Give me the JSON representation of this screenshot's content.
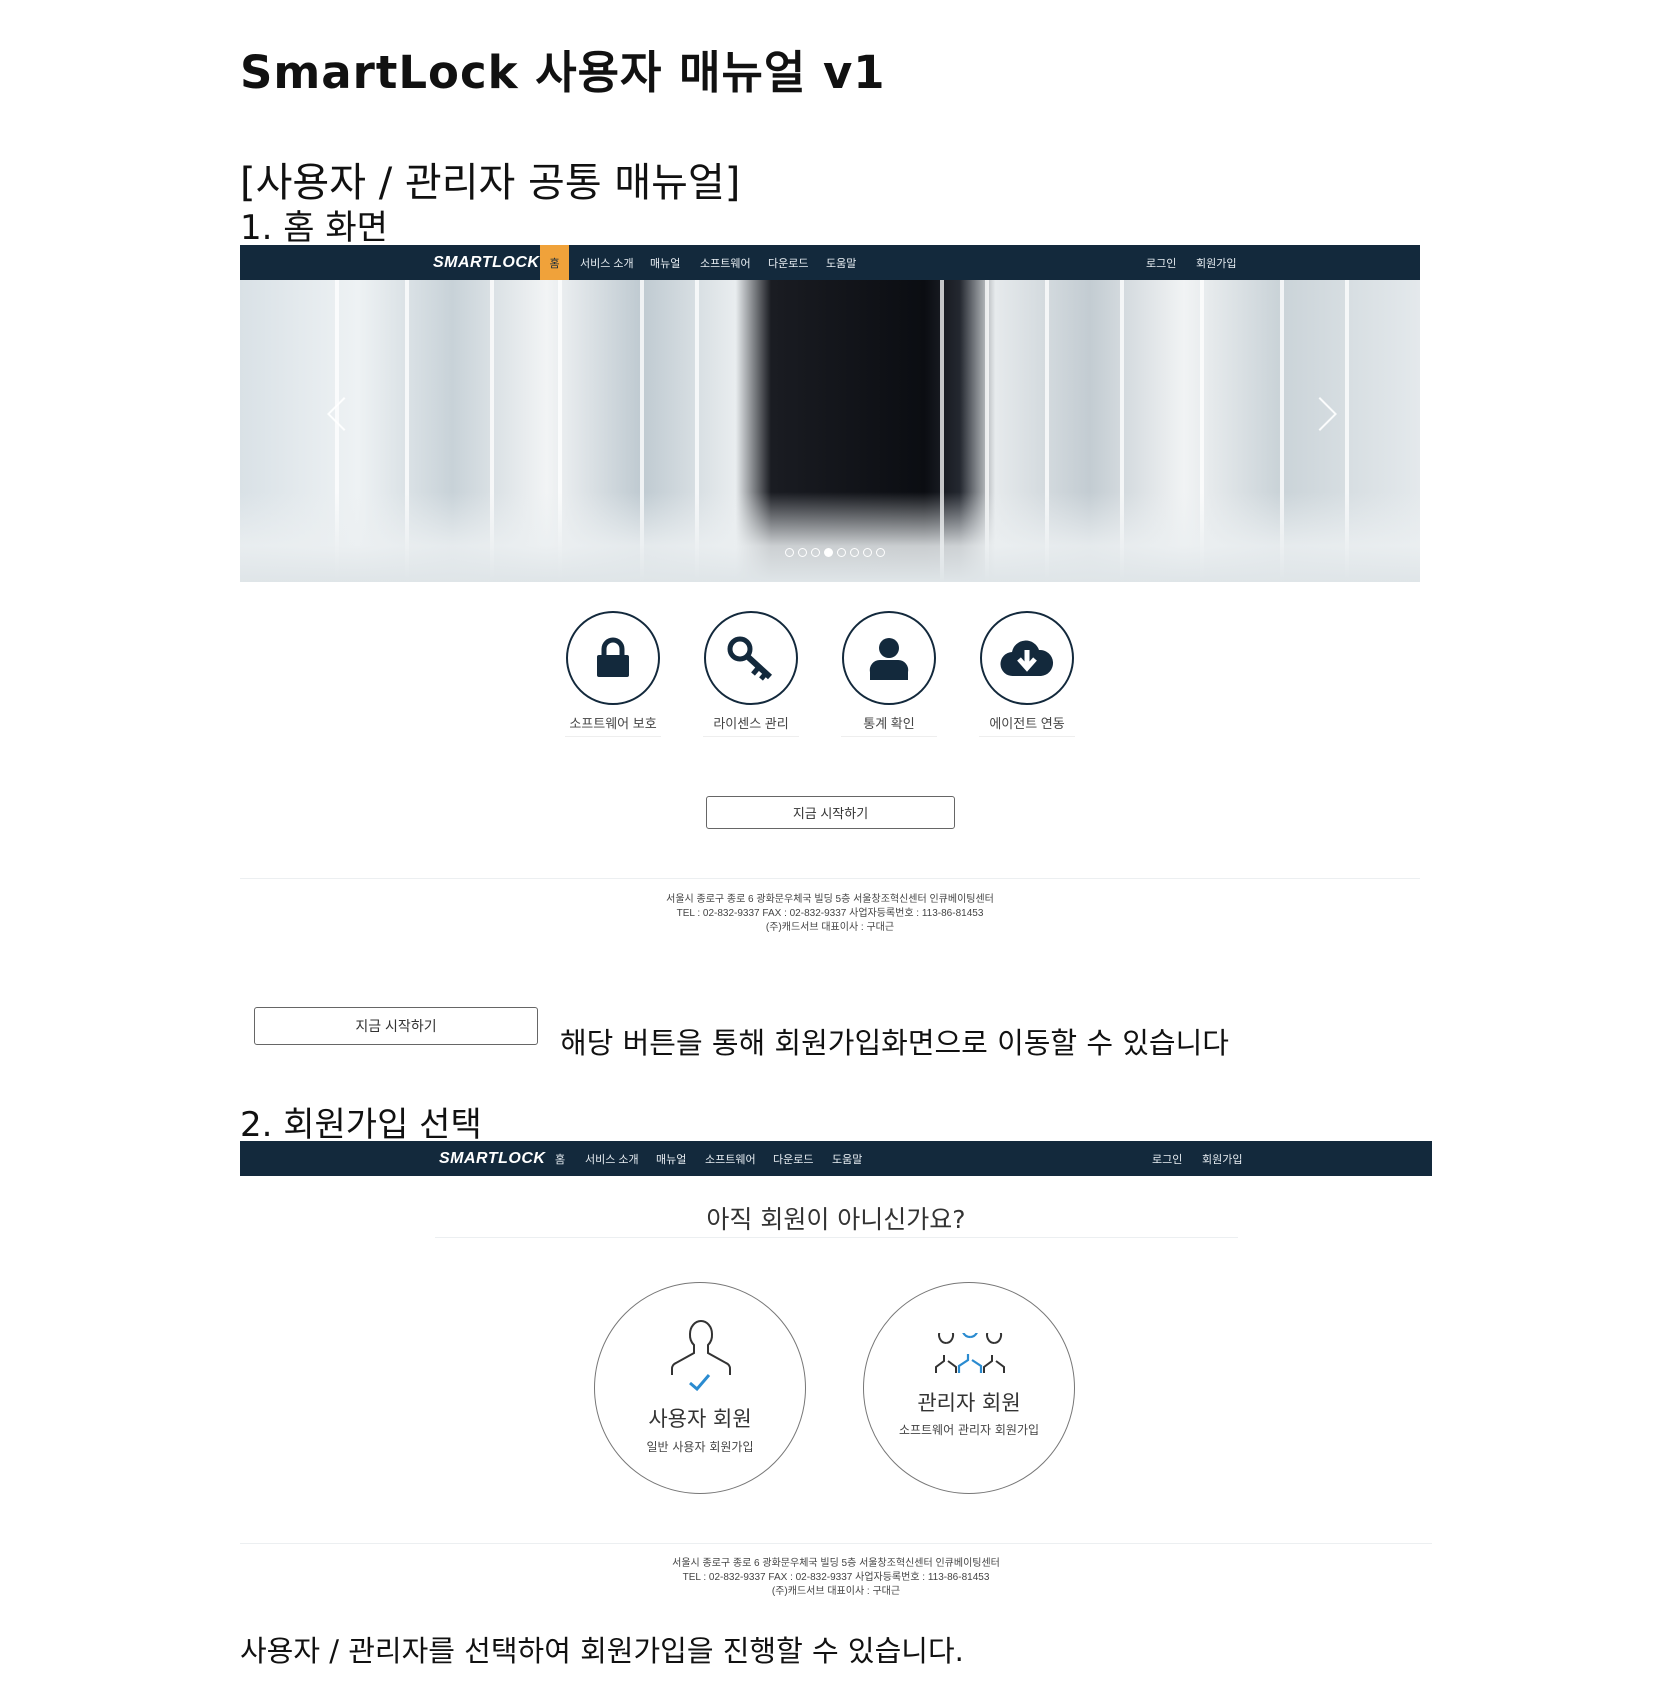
{
  "document": {
    "title": "SmartLock 사용자 매뉴얼 v1",
    "section_heading": "[사용자 / 관리자 공통 매뉴얼]",
    "step1_heading": "1. 홈 화면",
    "step1_description": "해당 버튼을 통해 회원가입화면으로 이동할 수 있습니다",
    "step2_heading": "2. 회원가입 선택",
    "step2_description": "사용자 / 관리자를 선택하여 회원가입을 진행할 수 있습니다."
  },
  "nav": {
    "logo": "SMARTLOCK",
    "items": [
      "홈",
      "서비스 소개",
      "매뉴얼",
      "소프트웨어",
      "다운로드",
      "도움말"
    ],
    "login": "로그인",
    "signup": "회원가입",
    "active_color": "#f0a23a",
    "bar_color": "#13293c"
  },
  "home_screen": {
    "carousel": {
      "slide_count": 8,
      "active_slide": 4
    },
    "features": [
      {
        "icon": "lock-icon",
        "label": "소프트웨어 보호"
      },
      {
        "icon": "key-icon",
        "label": "라이센스 관리"
      },
      {
        "icon": "user-icon",
        "label": "통계 확인"
      },
      {
        "icon": "cloud-download-icon",
        "label": "에이전트 연동"
      }
    ],
    "start_button": "지금 시작하기"
  },
  "footer": {
    "line1": "서울시 종로구 종로 6 광화문우체국 빌딩 5층 서울창조혁신센터 인큐베이팅센터",
    "line2": "TEL : 02-832-9337     FAX : 02-832-9337     사업자등록번호 : 113-86-81453",
    "line3": "(주)캐드서브     대표이사 : 구대근"
  },
  "callout_button": "지금 시작하기",
  "signup_screen": {
    "title": "아직 회원이 아니신가요?",
    "user_option": {
      "title": "사용자 회원",
      "subtitle": "일반 사용자 회원가입"
    },
    "admin_option": {
      "title": "관리자 회원",
      "subtitle": "소프트웨어 관리자 회원가입"
    },
    "accent_color": "#2a8bd0"
  }
}
